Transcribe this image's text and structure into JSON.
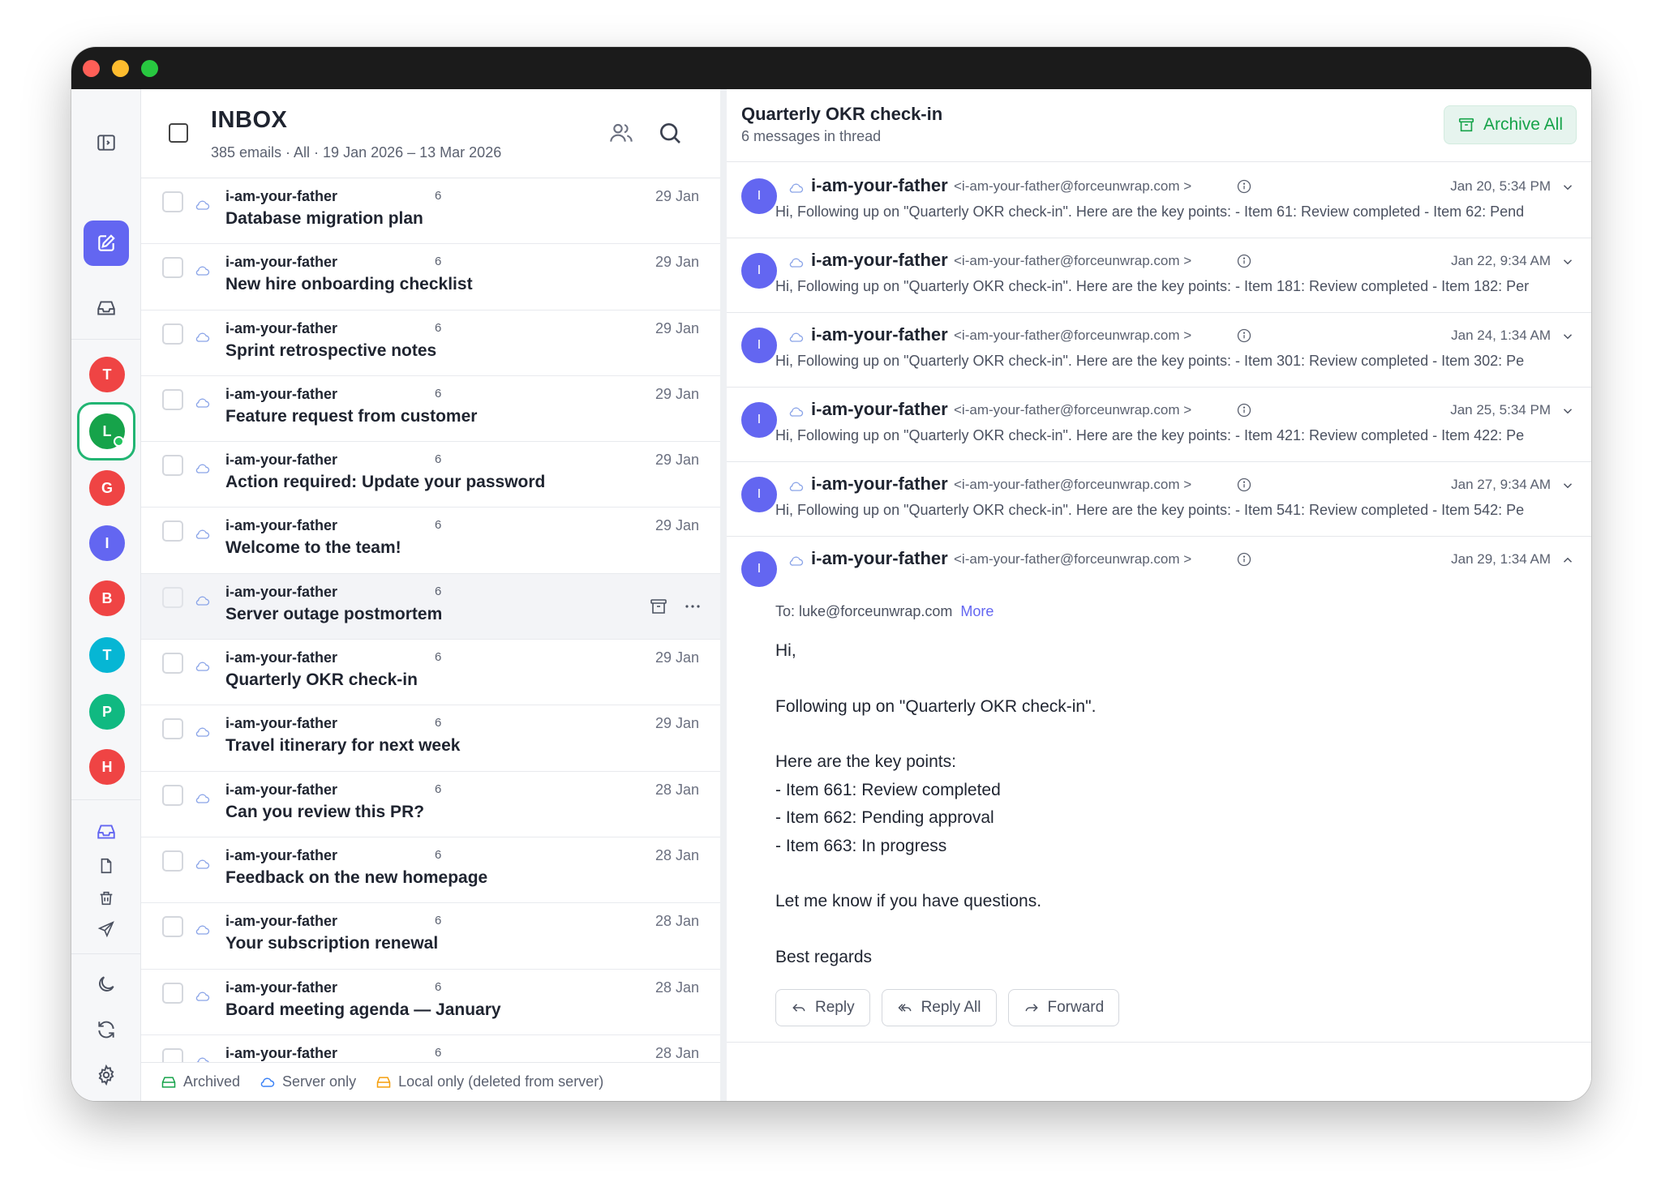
{
  "colors": {
    "accent": "#6366f1",
    "archive_green": "#16a34a",
    "avatar_T": "#ef4444",
    "avatar_L": "#16a34a",
    "avatar_G": "#ef4444",
    "avatar_I": "#6366f1",
    "avatar_B": "#ef4444",
    "avatar_T2": "#06b6d4",
    "avatar_P": "#10b981",
    "avatar_H": "#ef4444"
  },
  "sidebar": {
    "toggle_icon": "sidebar-toggle-icon",
    "compose_icon": "compose-icon",
    "unified_inbox_icon": "inbox-icon",
    "accounts": [
      {
        "letter": "T"
      },
      {
        "letter": "L"
      },
      {
        "letter": "G"
      },
      {
        "letter": "I"
      },
      {
        "letter": "B"
      },
      {
        "letter": "T"
      },
      {
        "letter": "P"
      },
      {
        "letter": "H"
      }
    ],
    "folder_icons": [
      "inbox-icon",
      "document-icon",
      "trash-icon",
      "send-icon"
    ],
    "bottom_icons": [
      "moon-icon",
      "sync-icon",
      "gear-icon",
      "storage-icon"
    ]
  },
  "list": {
    "title": "INBOX",
    "meta": "385 emails  ·  All  ·  19 Jan 2026 – 13 Mar 2026",
    "rows": [
      {
        "sender": "i-am-your-father",
        "count": "6",
        "subject": "Database migration plan",
        "date": "29 Jan"
      },
      {
        "sender": "i-am-your-father",
        "count": "6",
        "subject": "New hire onboarding checklist",
        "date": "29 Jan"
      },
      {
        "sender": "i-am-your-father",
        "count": "6",
        "subject": "Sprint retrospective notes",
        "date": "29 Jan"
      },
      {
        "sender": "i-am-your-father",
        "count": "6",
        "subject": "Feature request from customer",
        "date": "29 Jan"
      },
      {
        "sender": "i-am-your-father",
        "count": "6",
        "subject": "Action required: Update your password",
        "date": "29 Jan"
      },
      {
        "sender": "i-am-your-father",
        "count": "6",
        "subject": "Welcome to the team!",
        "date": "29 Jan"
      },
      {
        "sender": "i-am-your-father",
        "count": "6",
        "subject": "Server outage postmortem",
        "date": ""
      },
      {
        "sender": "i-am-your-father",
        "count": "6",
        "subject": "Quarterly OKR check-in",
        "date": "29 Jan"
      },
      {
        "sender": "i-am-your-father",
        "count": "6",
        "subject": "Travel itinerary for next week",
        "date": "29 Jan"
      },
      {
        "sender": "i-am-your-father",
        "count": "6",
        "subject": "Can you review this PR?",
        "date": "28 Jan"
      },
      {
        "sender": "i-am-your-father",
        "count": "6",
        "subject": "Feedback on the new homepage",
        "date": "28 Jan"
      },
      {
        "sender": "i-am-your-father",
        "count": "6",
        "subject": "Your subscription renewal",
        "date": "28 Jan"
      },
      {
        "sender": "i-am-your-father",
        "count": "6",
        "subject": "Board meeting agenda — January",
        "date": "28 Jan"
      },
      {
        "sender": "i-am-your-father",
        "count": "6",
        "subject": "",
        "date": "28 Jan"
      }
    ],
    "legend": {
      "archived": "Archived",
      "server_only": "Server only",
      "local_only": "Local only (deleted from server)"
    }
  },
  "thread": {
    "title": "Quarterly OKR check-in",
    "subtitle": "6 messages in thread",
    "archive_all": "Archive All",
    "messages": [
      {
        "avatar": "I",
        "sender": "i-am-your-father",
        "email": "<i-am-your-father@forceunwrap.com >",
        "date": "Jan 20, 5:34 PM",
        "preview": "Hi,  Following up on \"Quarterly OKR check-in\".  Here are the key points: - Item 61: Review completed - Item 62: Pend"
      },
      {
        "avatar": "I",
        "sender": "i-am-your-father",
        "email": "<i-am-your-father@forceunwrap.com >",
        "date": "Jan 22, 9:34 AM",
        "preview": "Hi,  Following up on \"Quarterly OKR check-in\".  Here are the key points: - Item 181: Review completed - Item 182: Per"
      },
      {
        "avatar": "I",
        "sender": "i-am-your-father",
        "email": "<i-am-your-father@forceunwrap.com >",
        "date": "Jan 24, 1:34 AM",
        "preview": "Hi,  Following up on \"Quarterly OKR check-in\".  Here are the key points: - Item 301: Review completed - Item 302: Pe"
      },
      {
        "avatar": "I",
        "sender": "i-am-your-father",
        "email": "<i-am-your-father@forceunwrap.com >",
        "date": "Jan 25, 5:34 PM",
        "preview": "Hi,  Following up on \"Quarterly OKR check-in\".  Here are the key points: - Item 421: Review completed - Item 422: Pe"
      },
      {
        "avatar": "I",
        "sender": "i-am-your-father",
        "email": "<i-am-your-father@forceunwrap.com >",
        "date": "Jan 27, 9:34 AM",
        "preview": "Hi,  Following up on \"Quarterly OKR check-in\".  Here are the key points: - Item 541: Review completed - Item 542: Pe"
      }
    ],
    "expanded": {
      "avatar": "I",
      "sender": "i-am-your-father",
      "email": "<i-am-your-father@forceunwrap.com >",
      "date": "Jan 29, 1:34 AM",
      "to": "To: luke@forceunwrap.com",
      "more": "More",
      "greeting": "Hi,",
      "line1": "Following up on \"Quarterly OKR check-in\".",
      "points_intro": "Here are the key points:",
      "point1": "- Item 661: Review completed",
      "point2": "- Item 662: Pending approval",
      "point3": "- Item 663: In progress",
      "closing": "Let me know if you have questions.",
      "signoff": "Best regards",
      "reply": "Reply",
      "reply_all": "Reply All",
      "forward": "Forward"
    }
  }
}
